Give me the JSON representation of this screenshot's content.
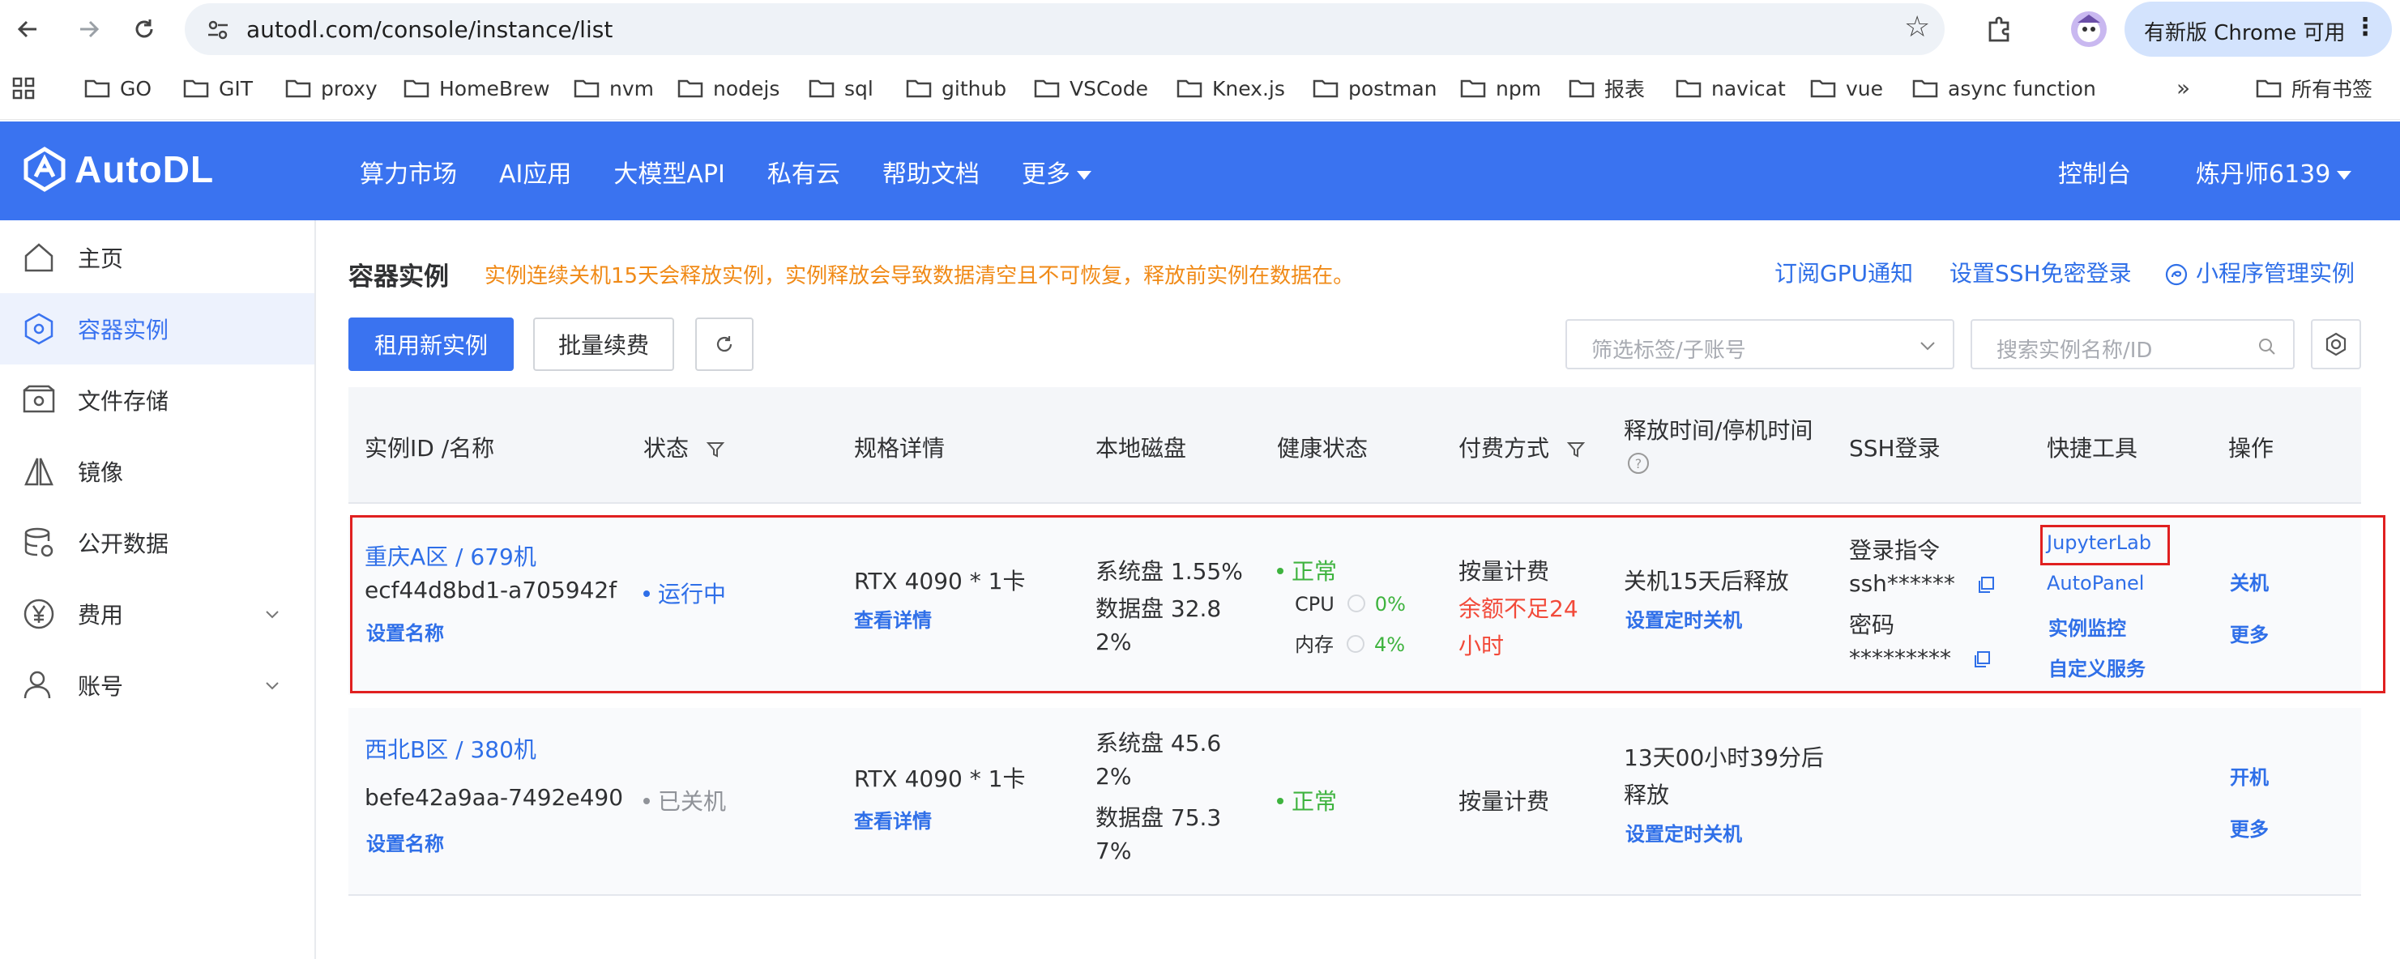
{
  "browser": {
    "url": "autodl.com/console/instance/list",
    "update_button": "有新版 Chrome 可用",
    "bookmarks": [
      "GO",
      "GIT",
      "proxy",
      "HomeBrew",
      "nvm",
      "nodejs",
      "sql",
      "github",
      "VSCode",
      "Knex.js",
      "postman",
      "npm",
      "报表",
      "navicat",
      "vue",
      "async function"
    ],
    "more_bookmarks": "»",
    "all_bookmarks": "所有书签"
  },
  "header": {
    "logo": "AutoDL",
    "nav": [
      "算力市场",
      "AI应用",
      "大模型API",
      "私有云",
      "帮助文档",
      "更多"
    ],
    "console": "控制台",
    "user": "炼丹师6139"
  },
  "sidebar": {
    "items": [
      {
        "label": "主页",
        "icon": "home-icon"
      },
      {
        "label": "容器实例",
        "icon": "cube-icon"
      },
      {
        "label": "文件存储",
        "icon": "storage-icon"
      },
      {
        "label": "镜像",
        "icon": "mirror-icon"
      },
      {
        "label": "公开数据",
        "icon": "database-icon"
      },
      {
        "label": "费用",
        "icon": "yen-icon"
      },
      {
        "label": "账号",
        "icon": "user-icon"
      }
    ]
  },
  "main": {
    "title": "容器实例",
    "warning": "实例连续关机15天会释放实例，实例释放会导致数据清空且不可恢复，释放前实例在数据在。",
    "links": {
      "gpu_notify": "订阅GPU通知",
      "ssh_setup": "设置SSH免密登录",
      "miniprogram": "小程序管理实例"
    },
    "buttons": {
      "rent": "租用新实例",
      "renew": "批量续费"
    },
    "filter_placeholder": "筛选标签/子账号",
    "search_placeholder": "搜索实例名称/ID",
    "columns": {
      "id": "实例ID /名称",
      "status": "状态",
      "spec": "规格详情",
      "disk": "本地磁盘",
      "health": "健康状态",
      "billing": "付费方式",
      "release": "释放时间/停机时间",
      "ssh": "SSH登录",
      "tools": "快捷工具",
      "ops": "操作"
    },
    "rows": [
      {
        "name": "重庆A区 / 679机",
        "id": "ecf44d8bd1-a705942f",
        "set_name": "设置名称",
        "status": "运行中",
        "gpu": "RTX 4090 * 1卡",
        "details": "查看详情",
        "disk_line1": "系统盘 1.55%",
        "disk_line2": "数据盘 32.8",
        "disk_line3": "2%",
        "health": "正常",
        "cpu_label": "CPU",
        "cpu_value": "0%",
        "mem_label": "内存",
        "mem_value": "4%",
        "billing": "按量计费",
        "balance_line1": "余额不足24",
        "balance_line2": "小时",
        "release": "关机15天后释放",
        "schedule": "设置定时关机",
        "ssh_cmd_label": "登录指令",
        "ssh_cmd": "ssh******",
        "pwd_label": "密码",
        "pwd": "*********",
        "tools": [
          "JupyterLab",
          "AutoPanel",
          "实例监控",
          "自定义服务"
        ],
        "op1": "关机",
        "op2": "更多"
      },
      {
        "name": "西北B区 / 380机",
        "id": "befe42a9aa-7492e490",
        "set_name": "设置名称",
        "status": "已关机",
        "gpu": "RTX 4090 * 1卡",
        "details": "查看详情",
        "disk_line1": "系统盘 45.6",
        "disk_line2": "2%",
        "disk_line3": "数据盘 75.3",
        "disk_line4": "7%",
        "health": "正常",
        "billing": "按量计费",
        "release_line1": "13天00小时39分后",
        "release_line2": "释放",
        "schedule": "设置定时关机",
        "op1": "开机",
        "op2": "更多"
      }
    ]
  },
  "colors": {
    "brand": "#3a73f0",
    "link": "#2f6fe8",
    "warning": "#f08a17",
    "success": "#3eb33e",
    "danger": "#f24a3a",
    "highlight": "#e02020"
  }
}
